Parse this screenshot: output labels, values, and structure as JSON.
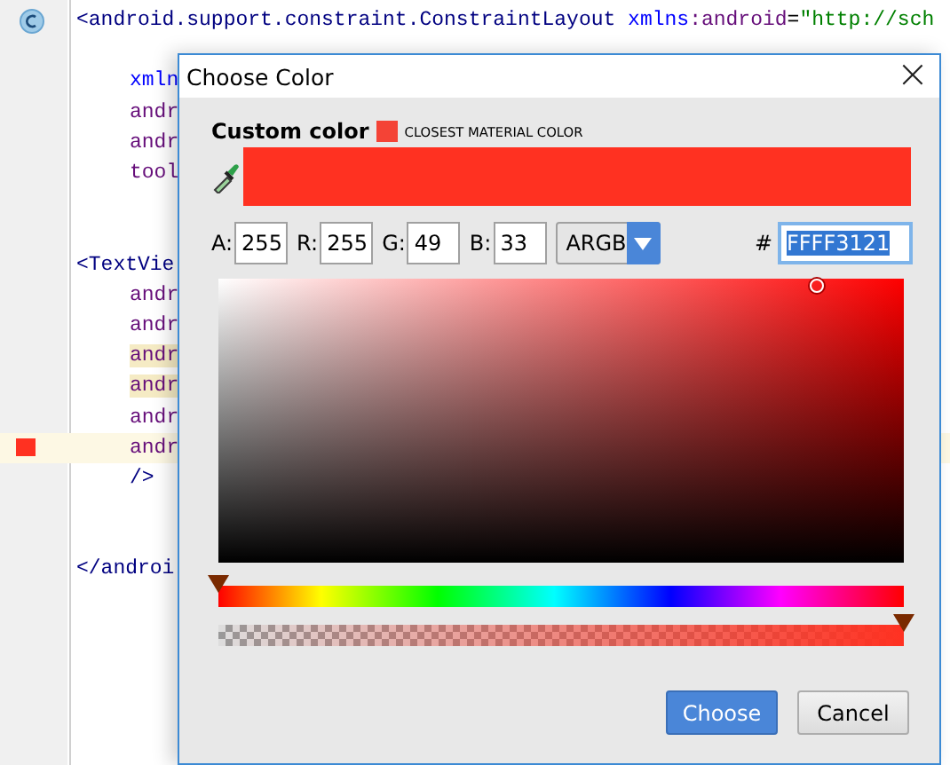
{
  "editor": {
    "lines": [
      {
        "kind": "tag",
        "marker": {
          "kind": "class"
        },
        "highlighted": false,
        "current": false,
        "segments": [
          {
            "text": "<android.support.constraint.ConstraintLayout",
            "kind": "tag"
          },
          {
            "text": " xmlns",
            "kind": "ns"
          },
          {
            "text": ":android",
            "kind": "attr"
          },
          {
            "text": "=",
            "kind": "plain"
          },
          {
            "text": "\"http://sch",
            "kind": "value"
          }
        ]
      },
      {
        "kind": "blank"
      },
      {
        "kind": "attr",
        "highlighted": false,
        "current": false,
        "segments": [
          {
            "text": "xmln",
            "kind": "ns"
          }
        ]
      },
      {
        "kind": "attr",
        "highlighted": false,
        "current": false,
        "segments": [
          {
            "text": "andr",
            "kind": "attr"
          }
        ]
      },
      {
        "kind": "attr",
        "highlighted": false,
        "current": false,
        "segments": [
          {
            "text": "andr",
            "kind": "attr"
          }
        ]
      },
      {
        "kind": "attr",
        "highlighted": false,
        "current": false,
        "segments": [
          {
            "text": "tool",
            "kind": "attr"
          }
        ]
      },
      {
        "kind": "blank"
      },
      {
        "kind": "blank"
      },
      {
        "kind": "tag",
        "highlighted": false,
        "current": false,
        "segments": [
          {
            "text": "<TextVie",
            "kind": "tag"
          }
        ]
      },
      {
        "kind": "attr",
        "highlighted": false,
        "current": false,
        "segments": [
          {
            "text": "andr",
            "kind": "attr"
          }
        ]
      },
      {
        "kind": "attr",
        "highlighted": false,
        "current": false,
        "segments": [
          {
            "text": "andr",
            "kind": "attr"
          }
        ]
      },
      {
        "kind": "attr",
        "highlighted": true,
        "current": false,
        "segments": [
          {
            "text": "andr",
            "kind": "attr"
          }
        ]
      },
      {
        "kind": "attr",
        "highlighted": true,
        "current": false,
        "segments": [
          {
            "text": "andr",
            "kind": "attr"
          }
        ]
      },
      {
        "kind": "attr",
        "highlighted": false,
        "current": false,
        "segments": [
          {
            "text": "andr",
            "kind": "attr"
          }
        ]
      },
      {
        "kind": "attr",
        "marker": {
          "kind": "swatch",
          "color": "#ff3121"
        },
        "highlighted": false,
        "current": true,
        "segments": [
          {
            "text": "andr",
            "kind": "attr"
          }
        ]
      },
      {
        "kind": "attr",
        "highlighted": false,
        "current": false,
        "segments": [
          {
            "text": "/>",
            "kind": "tag"
          }
        ]
      },
      {
        "kind": "blank"
      },
      {
        "kind": "blank"
      },
      {
        "kind": "tag",
        "highlighted": false,
        "current": false,
        "segments": [
          {
            "text": "</androi",
            "kind": "tag"
          }
        ]
      }
    ]
  },
  "dialog": {
    "title": "Choose Color",
    "close": "×",
    "custom_label": "Custom color",
    "closest_material": {
      "label": "CLOSEST MATERIAL COLOR",
      "color": "#f44336"
    },
    "preview": {
      "color": "#ff3121"
    },
    "channels": [
      {
        "label": "A:",
        "value": "255"
      },
      {
        "label": "R:",
        "value": "255"
      },
      {
        "label": "G:",
        "value": "49"
      },
      {
        "label": "B:",
        "value": "33"
      }
    ],
    "format": "ARGB",
    "hex_label": "#",
    "hex_value": "FFFF3121",
    "hex_selected": true,
    "hue": {
      "level": 0
    },
    "alpha": {
      "level": 1
    },
    "buttons": [
      {
        "label": "Choose",
        "primary": true
      },
      {
        "label": "Cancel",
        "primary": false
      }
    ]
  }
}
